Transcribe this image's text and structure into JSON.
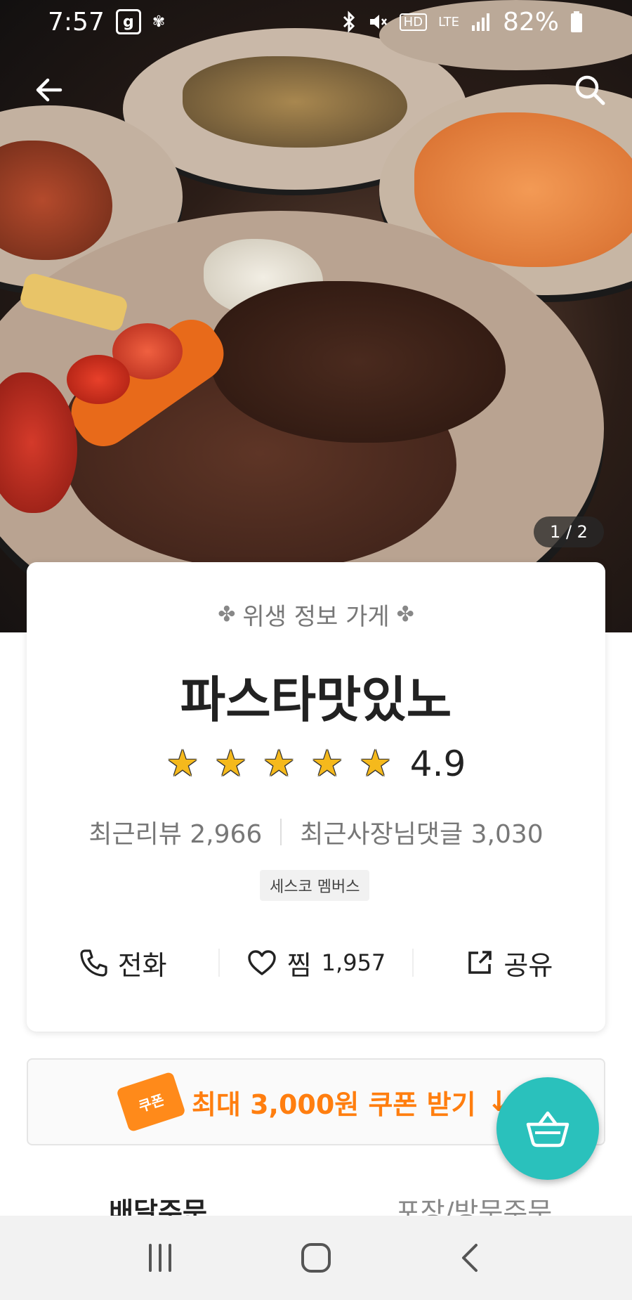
{
  "status_bar": {
    "time": "7:57",
    "left_icons": [
      "g",
      "✾"
    ],
    "network": "LTE",
    "hd_label": "HD",
    "battery_percent": "82%"
  },
  "photo": {
    "counter": "1 / 2"
  },
  "store": {
    "hygiene_label": "위생 정보 가게",
    "name": "파스타맛있노",
    "stars": [
      "★",
      "★",
      "★",
      "★",
      "★"
    ],
    "rating": "4.9",
    "recent_reviews_label": "최근리뷰 2,966",
    "owner_replies_label": "최근사장님댓글 3,030",
    "badge": "세스코 멤버스"
  },
  "actions": {
    "call_label": "전화",
    "like_label": "찜",
    "like_count": "1,957",
    "share_label": "공유"
  },
  "coupon": {
    "tag_text": "쿠폰",
    "text": "최대 3,000원 쿠폰 받기",
    "arrow": "↓"
  },
  "tabs": [
    "배달주문",
    "포장/방문주문"
  ],
  "colors": {
    "accent_teal": "#2ac1bc",
    "coupon_orange": "#ff7e0f",
    "star_yellow": "#f5b91c"
  },
  "icons": {
    "back": "back-arrow-icon",
    "search": "search-icon",
    "phone": "phone-icon",
    "heart": "heart-icon",
    "share": "share-icon",
    "cart": "shopping-basket-icon"
  }
}
